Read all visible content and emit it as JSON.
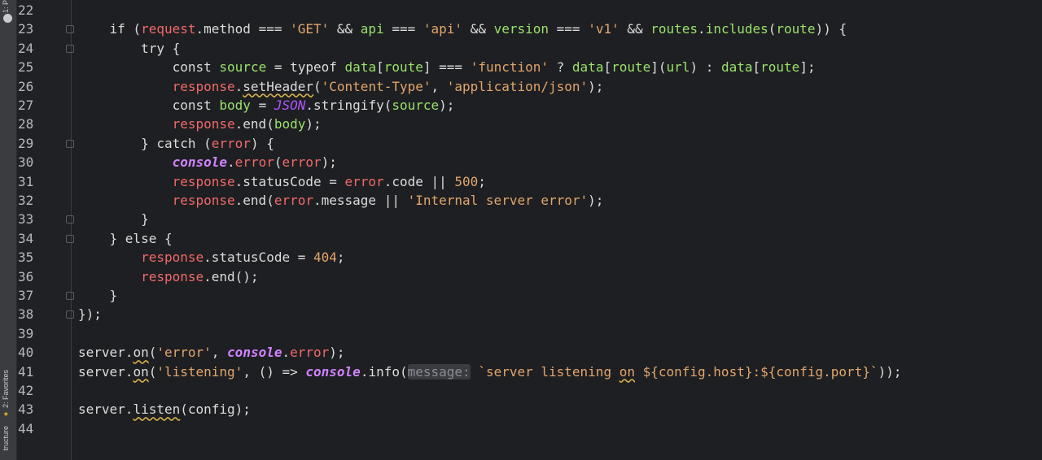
{
  "sidebar": {
    "project_tab": "1: P",
    "favorites_tab": "2: Favorites",
    "structure_tab": "tructure"
  },
  "editor": {
    "lines": [
      {
        "n": "22",
        "text": ""
      },
      {
        "n": "23",
        "text": "    if (request.method === 'GET' && api === 'api' && version === 'v1' && routes.includes(route)) {"
      },
      {
        "n": "24",
        "text": "        try {"
      },
      {
        "n": "25",
        "text": "            const source = typeof data[route] === 'function' ? data[route](url) : data[route];"
      },
      {
        "n": "26",
        "text": "            response.setHeader('Content-Type', 'application/json');"
      },
      {
        "n": "27",
        "text": "            const body = JSON.stringify(source);"
      },
      {
        "n": "28",
        "text": "            response.end(body);"
      },
      {
        "n": "29",
        "text": "        } catch (error) {"
      },
      {
        "n": "30",
        "text": "            console.error(error);"
      },
      {
        "n": "31",
        "text": "            response.statusCode = error.code || 500;"
      },
      {
        "n": "32",
        "text": "            response.end(error.message || 'Internal server error');"
      },
      {
        "n": "33",
        "text": "        }"
      },
      {
        "n": "34",
        "text": "    } else {"
      },
      {
        "n": "35",
        "text": "        response.statusCode = 404;"
      },
      {
        "n": "36",
        "text": "        response.end();"
      },
      {
        "n": "37",
        "text": "    }"
      },
      {
        "n": "38",
        "text": "});"
      },
      {
        "n": "39",
        "text": ""
      },
      {
        "n": "40",
        "text": "server.on('error', console.error);"
      },
      {
        "n": "41",
        "text": "server.on('listening', () => console.info(message: `server listening on ${config.host}:${config.port}`));"
      },
      {
        "n": "42",
        "text": ""
      },
      {
        "n": "43",
        "text": "server.listen(config);"
      },
      {
        "n": "44",
        "text": ""
      }
    ],
    "param_hint": "message:"
  }
}
